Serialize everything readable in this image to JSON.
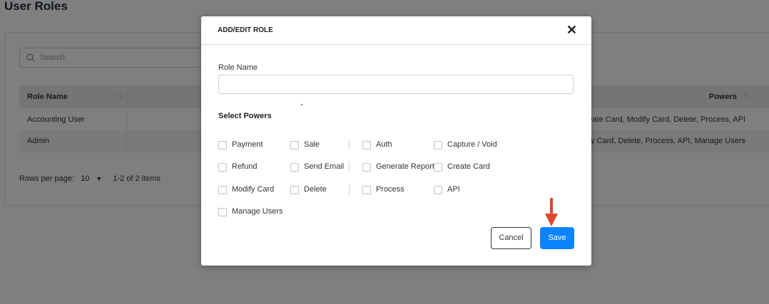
{
  "page": {
    "title": "User Roles",
    "search_placeholder": "Search",
    "table": {
      "columns": [
        "Role Name",
        "Powers"
      ],
      "sort_icon": "↑↓",
      "rows": [
        {
          "name": "Accounting User",
          "powers": "Create Card, Modify Card, Delete, Process, API"
        },
        {
          "name": "Admin",
          "powers": "dify Card, Delete, Process, API, Manage Users"
        }
      ]
    },
    "pager": {
      "rows_per_page_label": "Rows per page:",
      "rows_per_page_value": "10",
      "range_text": "1-2 of 2  items"
    }
  },
  "modal": {
    "title": "ADD/EDIT ROLE",
    "close_label": "✕",
    "role_name_label": "Role Name",
    "role_name_value": "",
    "select_powers_label": "Select Powers",
    "powers": [
      "Payment",
      "Sale",
      "Auth",
      "Capture / Void",
      "Refund",
      "Send Email",
      "Generate Report",
      "Create Card",
      "Modify Card",
      "Delete",
      "Process",
      "API",
      "Manage Users"
    ],
    "cancel_label": "Cancel",
    "save_label": "Save"
  },
  "colors": {
    "primary": "#0d84ff",
    "annotation_arrow": "#e0472f"
  },
  "icons": {
    "search": "search-icon",
    "close": "close-icon",
    "dropdown": "caret-down-icon",
    "annotation": "red-arrow-down-icon"
  }
}
